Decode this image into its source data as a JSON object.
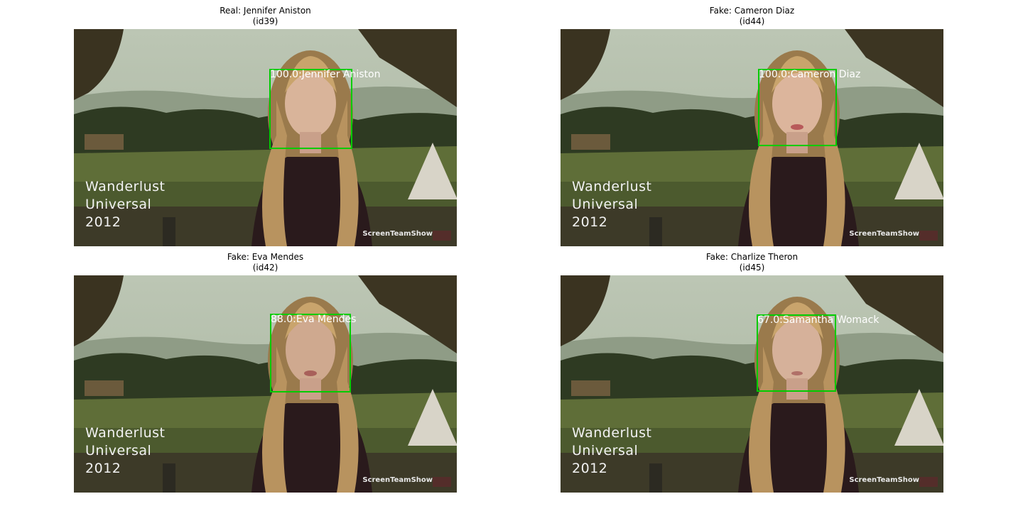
{
  "panels": [
    {
      "title_line1": "Real: Jennifer Aniston",
      "title_line2": "(id39)",
      "detection": "100.0:Jennifer Aniston",
      "overlay_lines": [
        "Wanderlust",
        "Universal",
        "2012"
      ],
      "watermark": "ScreenTeamShow"
    },
    {
      "title_line1": "Fake: Cameron Diaz",
      "title_line2": "(id44)",
      "detection": "100.0:Cameron Diaz",
      "overlay_lines": [
        "Wanderlust",
        "Universal",
        "2012"
      ],
      "watermark": "ScreenTeamShow"
    },
    {
      "title_line1": "Fake: Eva Mendes",
      "title_line2": "(id42)",
      "detection": "88.0:Eva Mendes",
      "overlay_lines": [
        "Wanderlust",
        "Universal",
        "2012"
      ],
      "watermark": "ScreenTeamShow"
    },
    {
      "title_line1": "Fake: Charlize Theron",
      "title_line2": "(id45)",
      "detection": "67.0:Samantha Womack",
      "overlay_lines": [
        "Wanderlust",
        "Universal",
        "2012"
      ],
      "watermark": "ScreenTeamShow"
    }
  ],
  "colors": {
    "bbox": "#00cc00",
    "detection_text": "#ffffff",
    "sky": "#b8c4b0",
    "hair": "#a8865a",
    "sweater": "#2a1a1c"
  }
}
